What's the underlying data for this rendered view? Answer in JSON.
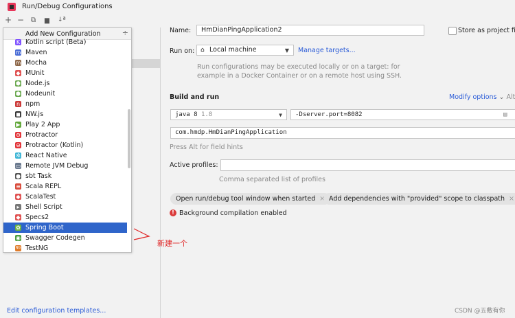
{
  "window": {
    "title": "Run/Debug Configurations"
  },
  "toolbar": {
    "add": "+",
    "remove": "−",
    "copy": "⧉",
    "folder": "▆",
    "sort": "↓ª"
  },
  "popup": {
    "header": "Add New Configuration",
    "collapse_glyph": "÷",
    "items": [
      {
        "label": "Kotlin script (Beta)",
        "icon": "kotlin-icon",
        "color": "#7f52ff",
        "glyph": "K"
      },
      {
        "label": "Maven",
        "icon": "maven-icon",
        "color": "#4a6cd6",
        "glyph": "m"
      },
      {
        "label": "Mocha",
        "icon": "mocha-icon",
        "color": "#8d6748",
        "glyph": "m"
      },
      {
        "label": "MUnit",
        "icon": "munit-icon",
        "color": "#e05252",
        "glyph": "◆"
      },
      {
        "label": "Node.js",
        "icon": "nodejs-icon",
        "color": "#6aa84f",
        "glyph": "⬢"
      },
      {
        "label": "Nodeunit",
        "icon": "nodeunit-icon",
        "color": "#6aa84f",
        "glyph": "⬢"
      },
      {
        "label": "npm",
        "icon": "npm-icon",
        "color": "#cb3837",
        "glyph": "n"
      },
      {
        "label": "NW.js",
        "icon": "nwjs-icon",
        "color": "#333333",
        "glyph": "◼"
      },
      {
        "label": "Play 2 App",
        "icon": "play-icon",
        "color": "#62a83a",
        "glyph": "▶"
      },
      {
        "label": "Protractor",
        "icon": "protractor-icon",
        "color": "#e23237",
        "glyph": "⊖"
      },
      {
        "label": "Protractor (Kotlin)",
        "icon": "protractor-kotlin-icon",
        "color": "#e23237",
        "glyph": "⊖"
      },
      {
        "label": "React Native",
        "icon": "react-icon",
        "color": "#3fb6d6",
        "glyph": "✲"
      },
      {
        "label": "Remote JVM Debug",
        "icon": "remote-debug-icon",
        "color": "#6b7a8f",
        "glyph": "▭"
      },
      {
        "label": "sbt Task",
        "icon": "sbt-icon",
        "color": "#555555",
        "glyph": "●"
      },
      {
        "label": "Scala REPL",
        "icon": "scala-repl-icon",
        "color": "#d84b3b",
        "glyph": "≡"
      },
      {
        "label": "ScalaTest",
        "icon": "scalatest-icon",
        "color": "#e05252",
        "glyph": "◆"
      },
      {
        "label": "Shell Script",
        "icon": "shell-icon",
        "color": "#777777",
        "glyph": "▸"
      },
      {
        "label": "Specs2",
        "icon": "specs2-icon",
        "color": "#e05252",
        "glyph": "◆"
      },
      {
        "label": "Spring Boot",
        "icon": "spring-boot-icon",
        "color": "#6db33f",
        "glyph": "✿"
      },
      {
        "label": "Swagger Codegen",
        "icon": "swagger-icon",
        "color": "#4a9e3f",
        "glyph": "◉"
      },
      {
        "label": "TestNG",
        "icon": "testng-icon",
        "color": "#e07b2a",
        "glyph": "NG"
      }
    ]
  },
  "edit_templates_link": "Edit configuration templates...",
  "form": {
    "name_label": "Name:",
    "name_value": "HmDianPingApplication2",
    "store_label": "Store as project file",
    "run_on_label": "Run on:",
    "run_on_value": "Local machine",
    "manage_targets": "Manage targets...",
    "run_on_hint_1": "Run configurations may be executed locally or on a target: for",
    "run_on_hint_2": "example in a Docker Container or on a remote host using SSH.",
    "build_run_label": "Build and run",
    "modify_options": "Modify options",
    "modify_shortcut": "Alt+M",
    "jdk_value": "java 8",
    "jdk_version": "1.8",
    "vm_options": "-Dserver.port=8082",
    "main_class": "com.hmdp.HmDianPingApplication",
    "field_hints": "Press Alt for field hints",
    "active_profiles_label": "Active profiles:",
    "active_profiles_value": "",
    "profiles_hint": "Comma separated list of profiles",
    "chip_1": "Open run/debug tool window when started",
    "chip_2": "Add dependencies with \"provided\" scope to classpath",
    "chip_close": "×",
    "bg_compile": "Background compilation enabled"
  },
  "annotation": {
    "text": "新建一个",
    "color": "#e02424"
  },
  "watermark": "CSDN @五敷有你"
}
